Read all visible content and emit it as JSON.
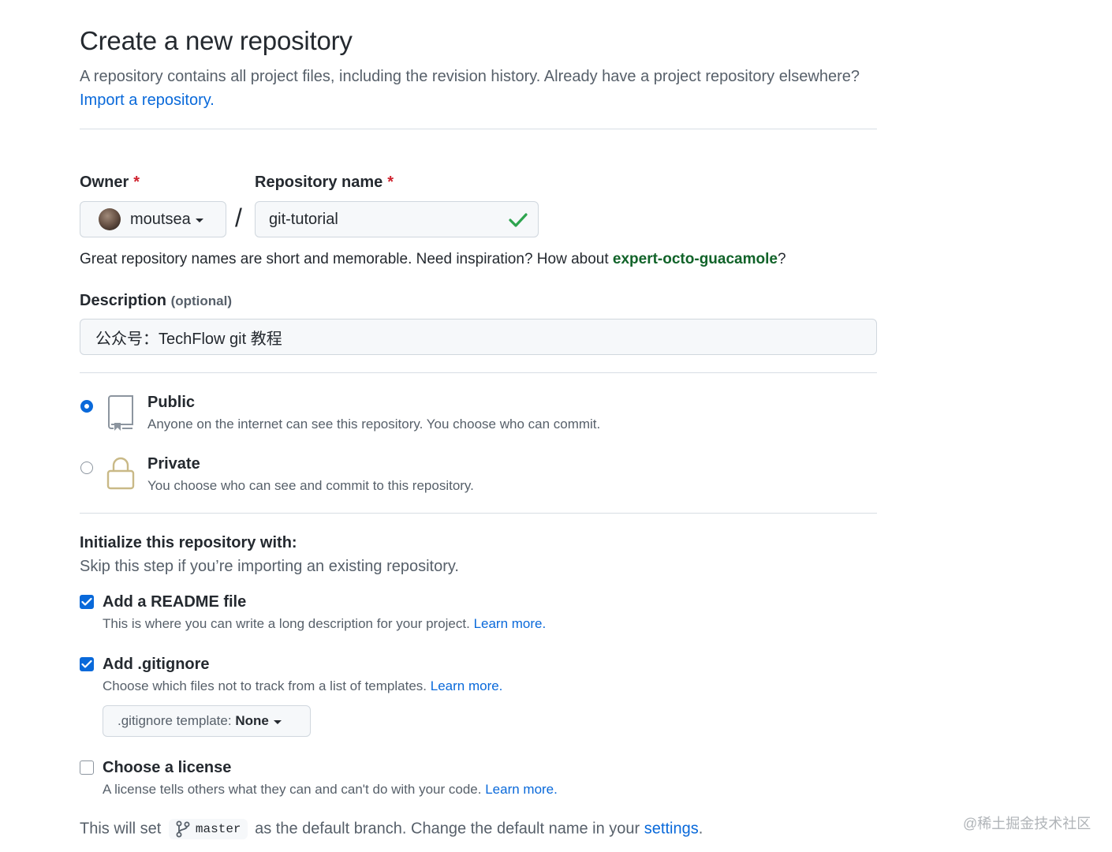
{
  "header": {
    "title": "Create a new repository",
    "lead_text": "A repository contains all project files, including the revision history. Already have a project repository elsewhere?",
    "import_link": "Import a repository."
  },
  "owner": {
    "label": "Owner",
    "required_mark": "*",
    "value": "moutsea"
  },
  "separator": "/",
  "repo_name": {
    "label": "Repository name",
    "required_mark": "*",
    "value": "git-tutorial"
  },
  "name_hint": {
    "text": "Great repository names are short and memorable. Need inspiration? How about",
    "suggestion": "expert-octo-guacamole",
    "suffix": "?"
  },
  "description": {
    "label": "Description",
    "optional": "(optional)",
    "value": "公众号：TechFlow git 教程"
  },
  "visibility": {
    "public": {
      "title": "Public",
      "desc": "Anyone on the internet can see this repository. You choose who can commit.",
      "selected": true
    },
    "private": {
      "title": "Private",
      "desc": "You choose who can see and commit to this repository.",
      "selected": false
    }
  },
  "init": {
    "title": "Initialize this repository with:",
    "subtitle": "Skip this step if you’re importing an existing repository.",
    "readme": {
      "label": "Add a README file",
      "desc": "This is where you can write a long description for your project.",
      "link": "Learn more.",
      "checked": true
    },
    "gitignore": {
      "label": "Add .gitignore",
      "desc": "Choose which files not to track from a list of templates.",
      "link": "Learn more.",
      "checked": true,
      "template_prefix": ".gitignore template:",
      "template_value": "None"
    },
    "license": {
      "label": "Choose a license",
      "desc": "A license tells others what they can and can't do with your code.",
      "link": "Learn more.",
      "checked": false
    }
  },
  "branch_note": {
    "prefix": "This will set",
    "branch": "master",
    "middle": "as the default branch. Change the default name in your",
    "link": "settings",
    "suffix": "."
  },
  "watermark": "@稀土掘金技术社区",
  "colors": {
    "accent": "#0969da",
    "success": "#2da44e",
    "danger": "#cf222e",
    "suggestion": "#116329"
  }
}
